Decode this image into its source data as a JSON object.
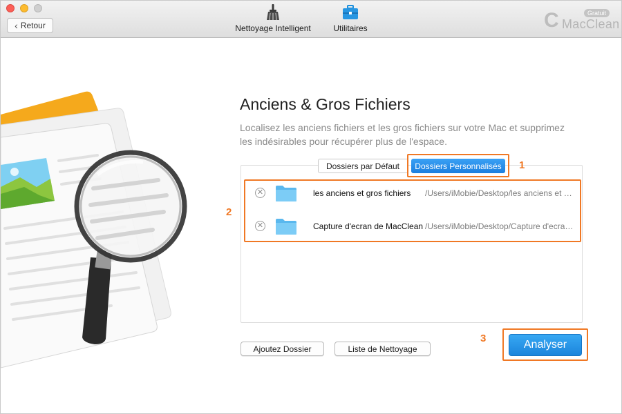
{
  "window": {
    "back_label": "Retour",
    "toolbar": [
      {
        "label": "Nettoyage Intelligent",
        "icon": "broom-icon"
      },
      {
        "label": "Utilitaires",
        "icon": "toolbox-icon"
      }
    ],
    "brand": {
      "name": "MacClean",
      "badge": "Gratuit"
    }
  },
  "main": {
    "title": "Anciens & Gros Fichiers",
    "description": "Localisez les anciens fichiers et les gros fichiers sur votre Mac et supprimez les indésirables pour récupérer plus de l'espace.",
    "tabs": [
      {
        "label": "Dossiers par Défaut",
        "selected": false
      },
      {
        "label": "Dossiers Personnalisés",
        "selected": true
      }
    ],
    "folders": [
      {
        "name": "les anciens et gros fichiers",
        "path": "/Users/iMobie/Desktop/les anciens et gros fichiers"
      },
      {
        "name": "Capture d'ecran de MacClean",
        "path": "/Users/iMobie/Desktop/Capture d'ecran de MacClean"
      }
    ],
    "buttons": {
      "add_folder": "Ajoutez Dossier",
      "clean_list": "Liste de Nettoyage",
      "analyze": "Analyser"
    }
  },
  "annotations": {
    "steps": [
      "1",
      "2",
      "3"
    ],
    "color": "#f07824"
  },
  "colors": {
    "accent": "#1b7fe0",
    "folder": "#5ab8ee"
  }
}
